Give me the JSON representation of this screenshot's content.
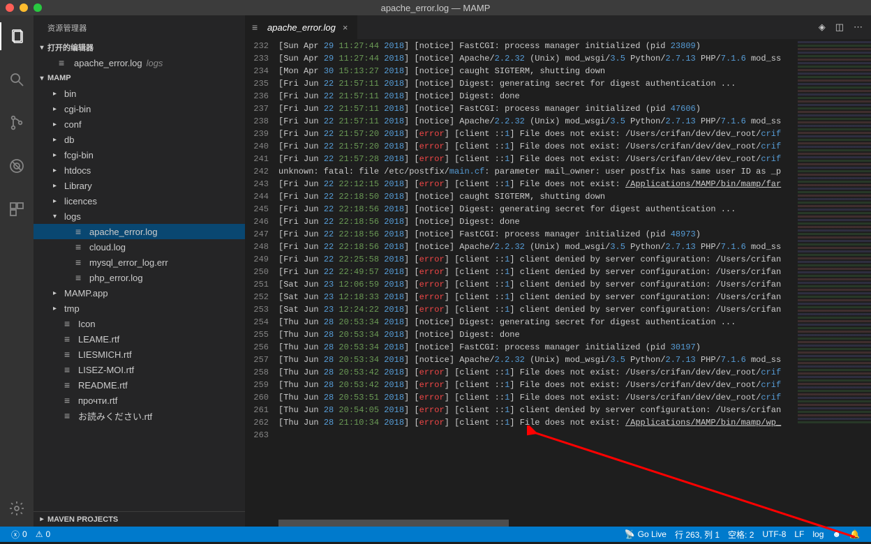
{
  "window": {
    "title": "apache_error.log — MAMP"
  },
  "sidebar": {
    "title": "资源管理器",
    "openEditorsHeader": "打开的编辑器",
    "openEditors": [
      {
        "name": "apache_error.log",
        "dir": "logs"
      }
    ],
    "rootHeader": "MAMP",
    "tree": [
      {
        "type": "folder",
        "name": "bin",
        "depth": 1,
        "open": false
      },
      {
        "type": "folder",
        "name": "cgi-bin",
        "depth": 1,
        "open": false
      },
      {
        "type": "folder",
        "name": "conf",
        "depth": 1,
        "open": false
      },
      {
        "type": "folder",
        "name": "db",
        "depth": 1,
        "open": false
      },
      {
        "type": "folder",
        "name": "fcgi-bin",
        "depth": 1,
        "open": false
      },
      {
        "type": "folder",
        "name": "htdocs",
        "depth": 1,
        "open": false
      },
      {
        "type": "folder",
        "name": "Library",
        "depth": 1,
        "open": false
      },
      {
        "type": "folder",
        "name": "licences",
        "depth": 1,
        "open": false
      },
      {
        "type": "folder",
        "name": "logs",
        "depth": 1,
        "open": true
      },
      {
        "type": "file",
        "name": "apache_error.log",
        "depth": 2,
        "selected": true
      },
      {
        "type": "file",
        "name": "cloud.log",
        "depth": 2
      },
      {
        "type": "file",
        "name": "mysql_error_log.err",
        "depth": 2
      },
      {
        "type": "file",
        "name": "php_error.log",
        "depth": 2
      },
      {
        "type": "folder",
        "name": "MAMP.app",
        "depth": 1,
        "open": false
      },
      {
        "type": "folder",
        "name": "tmp",
        "depth": 1,
        "open": false
      },
      {
        "type": "file",
        "name": "Icon",
        "depth": 1
      },
      {
        "type": "file",
        "name": "LEAME.rtf",
        "depth": 1
      },
      {
        "type": "file",
        "name": "LIESMICH.rtf",
        "depth": 1
      },
      {
        "type": "file",
        "name": "LISEZ-MOI.rtf",
        "depth": 1
      },
      {
        "type": "file",
        "name": "README.rtf",
        "depth": 1
      },
      {
        "type": "file",
        "name": "прочти.rtf",
        "depth": 1
      },
      {
        "type": "file",
        "name": "お読みください.rtf",
        "depth": 1
      }
    ],
    "mavenHeader": "MAVEN PROJECTS"
  },
  "tabs": {
    "active": {
      "name": "apache_error.log"
    }
  },
  "editor": {
    "firstLineNo": 232,
    "lines": [
      {
        "d": "[Sun Apr ",
        "n": "29",
        "t": " 11:27:44 ",
        "y": "2018",
        "rest": "] [notice] FastCGI: process manager initialized (pid ",
        "b2": "23809",
        "tail": ")"
      },
      {
        "d": "[Sun Apr ",
        "n": "29",
        "t": " 11:27:44 ",
        "y": "2018",
        "rest": "] [notice] Apache/",
        "b2": "2.2.32",
        "mid": " (Unix) mod_wsgi/",
        "b3": "3.5",
        "mid2": " Python/",
        "b4": "2.7.13",
        "mid3": " PHP/",
        "b5": "7.1.6",
        "tail": " mod_ss"
      },
      {
        "d": "[Mon Apr ",
        "n": "30",
        "t": " 15:13:27 ",
        "y": "2018",
        "rest": "] [notice] caught SIGTERM, shutting down"
      },
      {
        "d": "[Fri Jun ",
        "n": "22",
        "t": " 21:57:11 ",
        "y": "2018",
        "rest": "] [notice] Digest: generating secret for digest authentication ..."
      },
      {
        "d": "[Fri Jun ",
        "n": "22",
        "t": " 21:57:11 ",
        "y": "2018",
        "rest": "] [notice] Digest: done"
      },
      {
        "d": "[Fri Jun ",
        "n": "22",
        "t": " 21:57:11 ",
        "y": "2018",
        "rest": "] [notice] FastCGI: process manager initialized (pid ",
        "b2": "47606",
        "tail": ")"
      },
      {
        "d": "[Fri Jun ",
        "n": "22",
        "t": " 21:57:11 ",
        "y": "2018",
        "rest": "] [notice] Apache/",
        "b2": "2.2.32",
        "mid": " (Unix) mod_wsgi/",
        "b3": "3.5",
        "mid2": " Python/",
        "b4": "2.7.13",
        "mid3": " PHP/",
        "b5": "7.1.6",
        "tail": " mod_ss"
      },
      {
        "d": "[Fri Jun ",
        "n": "22",
        "t": " 21:57:20 ",
        "y": "2018",
        "err": true,
        "rest": "] [client ::",
        "b2": "1",
        "mid": "] File does not exist: /Users/crifan/dev/dev_root/",
        "b3": "crif"
      },
      {
        "d": "[Fri Jun ",
        "n": "22",
        "t": " 21:57:20 ",
        "y": "2018",
        "err": true,
        "rest": "] [client ::",
        "b2": "1",
        "mid": "] File does not exist: /Users/crifan/dev/dev_root/",
        "b3": "crif"
      },
      {
        "d": "[Fri Jun ",
        "n": "22",
        "t": " 21:57:28 ",
        "y": "2018",
        "err": true,
        "rest": "] [client ::",
        "b2": "1",
        "mid": "] File does not exist: /Users/crifan/dev/dev_root/",
        "b3": "crif"
      },
      {
        "raw": "unknown: fatal: file /etc/postfix/",
        "b2": "main.cf",
        "tail": ": parameter mail_owner: user postfix has same user ID as _p"
      },
      {
        "d": "[Fri Jun ",
        "n": "22",
        "t": " 22:12:15 ",
        "y": "2018",
        "err": true,
        "rest": "] [client ::",
        "b2": "1",
        "mid": "] File does not exist: ",
        "u": "/Applications/MAMP/bin/mamp/far"
      },
      {
        "d": "[Fri Jun ",
        "n": "22",
        "t": " 22:18:50 ",
        "y": "2018",
        "rest": "] [notice] caught SIGTERM, shutting down"
      },
      {
        "d": "[Fri Jun ",
        "n": "22",
        "t": " 22:18:56 ",
        "y": "2018",
        "rest": "] [notice] Digest: generating secret for digest authentication ..."
      },
      {
        "d": "[Fri Jun ",
        "n": "22",
        "t": " 22:18:56 ",
        "y": "2018",
        "rest": "] [notice] Digest: done"
      },
      {
        "d": "[Fri Jun ",
        "n": "22",
        "t": " 22:18:56 ",
        "y": "2018",
        "rest": "] [notice] FastCGI: process manager initialized (pid ",
        "b2": "48973",
        "tail": ")"
      },
      {
        "d": "[Fri Jun ",
        "n": "22",
        "t": " 22:18:56 ",
        "y": "2018",
        "rest": "] [notice] Apache/",
        "b2": "2.2.32",
        "mid": " (Unix) mod_wsgi/",
        "b3": "3.5",
        "mid2": " Python/",
        "b4": "2.7.13",
        "mid3": " PHP/",
        "b5": "7.1.6",
        "tail": " mod_ss"
      },
      {
        "d": "[Fri Jun ",
        "n": "22",
        "t": " 22:25:58 ",
        "y": "2018",
        "err": true,
        "rest": "] [client ::",
        "b2": "1",
        "mid": "] client denied by server configuration: /Users/crifan"
      },
      {
        "d": "[Fri Jun ",
        "n": "22",
        "t": " 22:49:57 ",
        "y": "2018",
        "err": true,
        "rest": "] [client ::",
        "b2": "1",
        "mid": "] client denied by server configuration: /Users/crifan"
      },
      {
        "d": "[Sat Jun ",
        "n": "23",
        "t": " 12:06:59 ",
        "y": "2018",
        "err": true,
        "rest": "] [client ::",
        "b2": "1",
        "mid": "] client denied by server configuration: /Users/crifan"
      },
      {
        "d": "[Sat Jun ",
        "n": "23",
        "t": " 12:18:33 ",
        "y": "2018",
        "err": true,
        "rest": "] [client ::",
        "b2": "1",
        "mid": "] client denied by server configuration: /Users/crifan"
      },
      {
        "d": "[Sat Jun ",
        "n": "23",
        "t": " 12:24:22 ",
        "y": "2018",
        "err": true,
        "rest": "] [client ::",
        "b2": "1",
        "mid": "] client denied by server configuration: /Users/crifan"
      },
      {
        "d": "[Thu Jun ",
        "n": "28",
        "t": " 20:53:34 ",
        "y": "2018",
        "rest": "] [notice] Digest: generating secret for digest authentication ..."
      },
      {
        "d": "[Thu Jun ",
        "n": "28",
        "t": " 20:53:34 ",
        "y": "2018",
        "rest": "] [notice] Digest: done"
      },
      {
        "d": "[Thu Jun ",
        "n": "28",
        "t": " 20:53:34 ",
        "y": "2018",
        "rest": "] [notice] FastCGI: process manager initialized (pid ",
        "b2": "30197",
        "tail": ")"
      },
      {
        "d": "[Thu Jun ",
        "n": "28",
        "t": " 20:53:34 ",
        "y": "2018",
        "rest": "] [notice] Apache/",
        "b2": "2.2.32",
        "mid": " (Unix) mod_wsgi/",
        "b3": "3.5",
        "mid2": " Python/",
        "b4": "2.7.13",
        "mid3": " PHP/",
        "b5": "7.1.6",
        "tail": " mod_ss"
      },
      {
        "d": "[Thu Jun ",
        "n": "28",
        "t": " 20:53:42 ",
        "y": "2018",
        "err": true,
        "rest": "] [client ::",
        "b2": "1",
        "mid": "] File does not exist: /Users/crifan/dev/dev_root/",
        "b3": "crif"
      },
      {
        "d": "[Thu Jun ",
        "n": "28",
        "t": " 20:53:42 ",
        "y": "2018",
        "err": true,
        "rest": "] [client ::",
        "b2": "1",
        "mid": "] File does not exist: /Users/crifan/dev/dev_root/",
        "b3": "crif"
      },
      {
        "d": "[Thu Jun ",
        "n": "28",
        "t": " 20:53:51 ",
        "y": "2018",
        "err": true,
        "rest": "] [client ::",
        "b2": "1",
        "mid": "] File does not exist: /Users/crifan/dev/dev_root/",
        "b3": "crif"
      },
      {
        "d": "[Thu Jun ",
        "n": "28",
        "t": " 20:54:05 ",
        "y": "2018",
        "err": true,
        "rest": "] [client ::",
        "b2": "1",
        "mid": "] client denied by server configuration: /Users/crifan"
      },
      {
        "d": "[Thu Jun ",
        "n": "28",
        "t": " 21:10:34 ",
        "y": "2018",
        "err": true,
        "rest": "] [client ::",
        "b2": "1",
        "mid": "] File does not exist: ",
        "u": "/Applications/MAMP/bin/mamp/wp_"
      },
      {
        "raw": ""
      }
    ]
  },
  "status": {
    "errors": "0",
    "warnings": "0",
    "goLive": "Go Live",
    "lncol": "行 263, 列 1",
    "spaces": "空格: 2",
    "encoding": "UTF-8",
    "eol": "LF",
    "lang": "log"
  }
}
